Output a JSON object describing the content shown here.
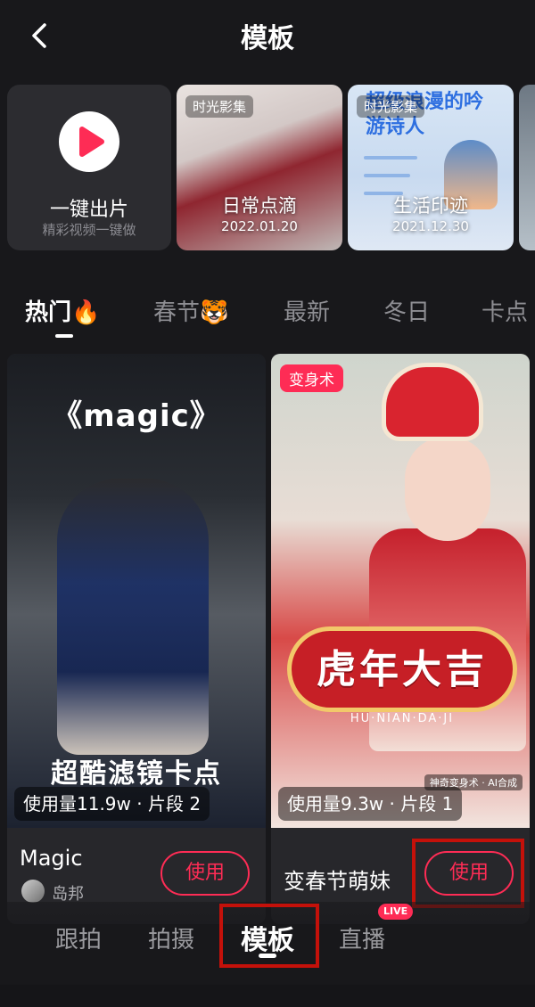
{
  "header": {
    "title": "模板"
  },
  "shortcuts": {
    "oneclick": {
      "title": "一键出片",
      "subtitle": "精彩视频一键做"
    },
    "albums": [
      {
        "tag": "时光影集",
        "title": "日常点滴",
        "date": "2022.01.20"
      },
      {
        "tag": "时光影集",
        "title": "生活印迹",
        "date": "2021.12.30",
        "headline": "超级浪漫的吟游诗人"
      }
    ]
  },
  "tabs": [
    "热门🔥",
    "春节🐯",
    "最新",
    "冬日",
    "卡点"
  ],
  "templates": [
    {
      "cover_title": "《magic》",
      "cover_caption": "超酷滤镜卡点",
      "usage": "使用量11.9w · 片段 2",
      "name": "Magic",
      "author": "岛邦",
      "button": "使用"
    },
    {
      "tag": "变身术",
      "cover_caption": "虎年大吉",
      "cover_sub": "HU·NIAN·DA·JI",
      "cover_mark": "神奇变身术 · AI合成",
      "usage": "使用量9.3w · 片段 1",
      "name": "变春节萌妹",
      "button": "使用"
    }
  ],
  "bottom_nav": {
    "items": [
      "跟拍",
      "拍摄",
      "模板",
      "直播"
    ],
    "live_badge": "LIVE"
  },
  "colors": {
    "accent": "#fe2c55",
    "highlight": "#c4110a",
    "background": "#18181b"
  }
}
